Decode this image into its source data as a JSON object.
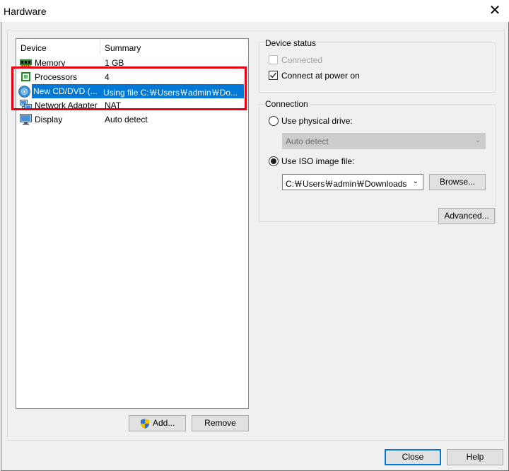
{
  "window": {
    "title": "Hardware",
    "close_glyph": "✕"
  },
  "device_list": {
    "columns": [
      "Device",
      "Summary"
    ],
    "rows": [
      {
        "device": "Memory",
        "summary": "1 GB",
        "icon": "memory-icon"
      },
      {
        "device": "Processors",
        "summary": "4",
        "icon": "processor-icon"
      },
      {
        "device": "New CD/DVD (...",
        "summary": "Using file C:￦Users￦admin￦Do...",
        "icon": "cd-dvd-icon",
        "selected": true
      },
      {
        "device": "Network Adapter",
        "summary": "NAT",
        "icon": "network-adapter-icon"
      },
      {
        "device": "Display",
        "summary": "Auto detect",
        "icon": "display-icon"
      }
    ]
  },
  "buttons": {
    "add": "Add...",
    "remove": "Remove",
    "browse": "Browse...",
    "advanced": "Advanced...",
    "close": "Close",
    "help": "Help"
  },
  "device_status": {
    "label": "Device status",
    "connected": {
      "label": "Connected",
      "checked": false,
      "enabled": false
    },
    "connect_at_power_on": {
      "label": "Connect at power on",
      "checked": true,
      "enabled": true
    }
  },
  "connection": {
    "label": "Connection",
    "physical_drive": {
      "label": "Use physical drive:",
      "selected": false,
      "value": "Auto detect",
      "enabled": false
    },
    "iso_image": {
      "label": "Use ISO image file:",
      "selected": true,
      "value": "C:￦Users￦admin￦Downloads"
    }
  },
  "colors": {
    "selection": "#0078d7",
    "highlight_box": "#e60012"
  }
}
